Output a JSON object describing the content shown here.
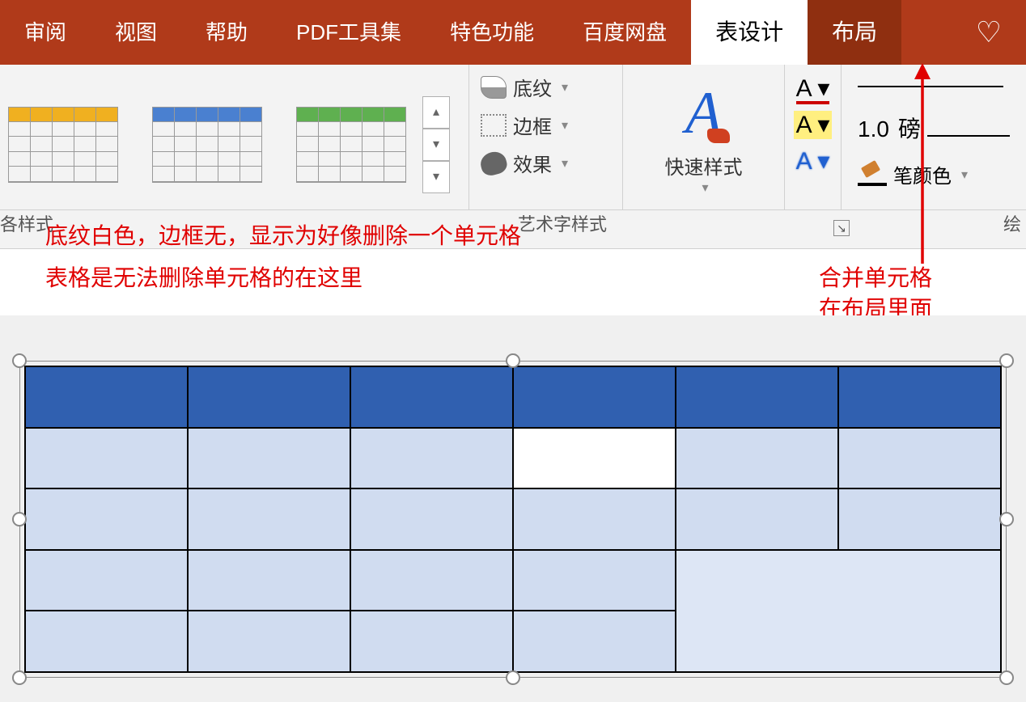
{
  "tabs": {
    "review": "审阅",
    "view": "视图",
    "help": "帮助",
    "pdf_tools": "PDF工具集",
    "features": "特色功能",
    "baidu_disk": "百度网盘",
    "table_design": "表设计",
    "layout": "布局"
  },
  "shading_borders": {
    "shading": "底纹",
    "borders": "边框",
    "effects": "效果"
  },
  "quick_styles": {
    "label": "快速样式"
  },
  "border_controls": {
    "weight_value": "1.0",
    "weight_unit": "磅",
    "pen_color": "笔颜色"
  },
  "group_labels": {
    "styles": "各样式",
    "wordart": "艺术字样式",
    "draw": "绘"
  },
  "annotations": {
    "line1": "底纹白色，边框无，显示为好像删除一个单元格",
    "line2": "表格是无法删除单元格的在这里",
    "merge1": "合并单元格",
    "merge2": "在布局里面"
  }
}
